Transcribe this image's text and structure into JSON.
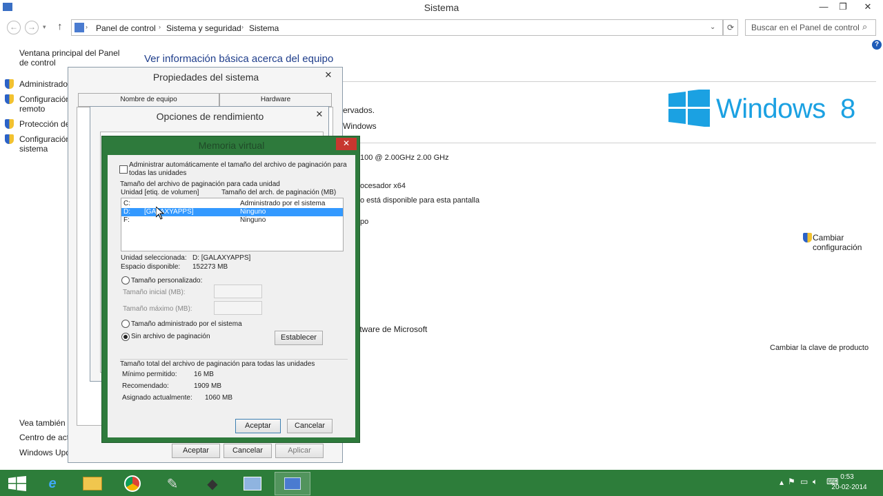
{
  "window": {
    "title": "Sistema",
    "minimize": "—",
    "restore": "❐",
    "close": "✕"
  },
  "address": {
    "crumbs": [
      "Panel de control",
      "Sistema y seguridad",
      "Sistema"
    ],
    "search_placeholder": "Buscar en el Panel de control"
  },
  "sidebar": {
    "home": "Ventana principal del Panel de control",
    "items": [
      "Administrador",
      "Configuración remoto",
      "Protección del",
      "Configuración sistema"
    ],
    "see_also": "Vea también",
    "see_items": [
      "Centro de actividad",
      "Windows Update"
    ]
  },
  "main": {
    "heading": "Ver información básica acerca del equipo",
    "reserved": "ervados.",
    "windows_link": "Windows",
    "cpu": "100  @ 2.00GHz   2.00 GHz",
    "arch": "ocesador x64",
    "pen": "o está disponible para esta pantalla",
    "po": "po",
    "change_config": "Cambiar configuración",
    "ms": "ftware de Microsoft",
    "product_key": "Cambiar la clave de producto",
    "win_logo": "Windows",
    "win_ver": "8"
  },
  "sysprops": {
    "title": "Propiedades del sistema",
    "tabs": [
      "Nombre de equipo",
      "Hardware"
    ],
    "ok": "Aceptar",
    "cancel": "Cancelar",
    "apply": "Aplicar"
  },
  "perf": {
    "title": "Opciones de rendimiento"
  },
  "vm": {
    "title": "Memoria virtual",
    "auto": "Administrar automáticamente el tamaño del archivo de paginación para todas las unidades",
    "group": "Tamaño del archivo de paginación para cada unidad",
    "col1": "Unidad [etiq. de volumen]",
    "col2": "Tamaño del arch. de paginación (MB)",
    "rows": [
      {
        "drive": "C:",
        "label": "",
        "size": "Administrado por el sistema"
      },
      {
        "drive": "D:",
        "label": "[GALAXYAPPS]",
        "size": "Ninguno"
      },
      {
        "drive": "F:",
        "label": "",
        "size": "Ninguno"
      }
    ],
    "sel_label": "Unidad seleccionada:",
    "sel_value": "D:  [GALAXYAPPS]",
    "free_label": "Espacio disponible:",
    "free_value": "152273 MB",
    "custom": "Tamaño personalizado:",
    "initial": "Tamaño inicial (MB):",
    "max": "Tamaño máximo (MB):",
    "managed": "Tamaño administrado por el sistema",
    "nofile": "Sin archivo de paginación",
    "set": "Establecer",
    "total_group": "Tamaño total del archivo de paginación para todas las unidades",
    "min_label": "Mínimo permitido:",
    "min_value": "16 MB",
    "rec_label": "Recomendado:",
    "rec_value": "1909 MB",
    "alloc_label": "Asignado actualmente:",
    "alloc_value": "1060 MB",
    "ok": "Aceptar",
    "cancel": "Cancelar"
  },
  "taskbar": {
    "time": "0:53",
    "date": "20-02-2014"
  },
  "colors": {
    "taskbar": "#2d7d3a",
    "link": "#1e5bb8",
    "win_blue": "#1ba1e2",
    "selection": "#3399ff"
  }
}
